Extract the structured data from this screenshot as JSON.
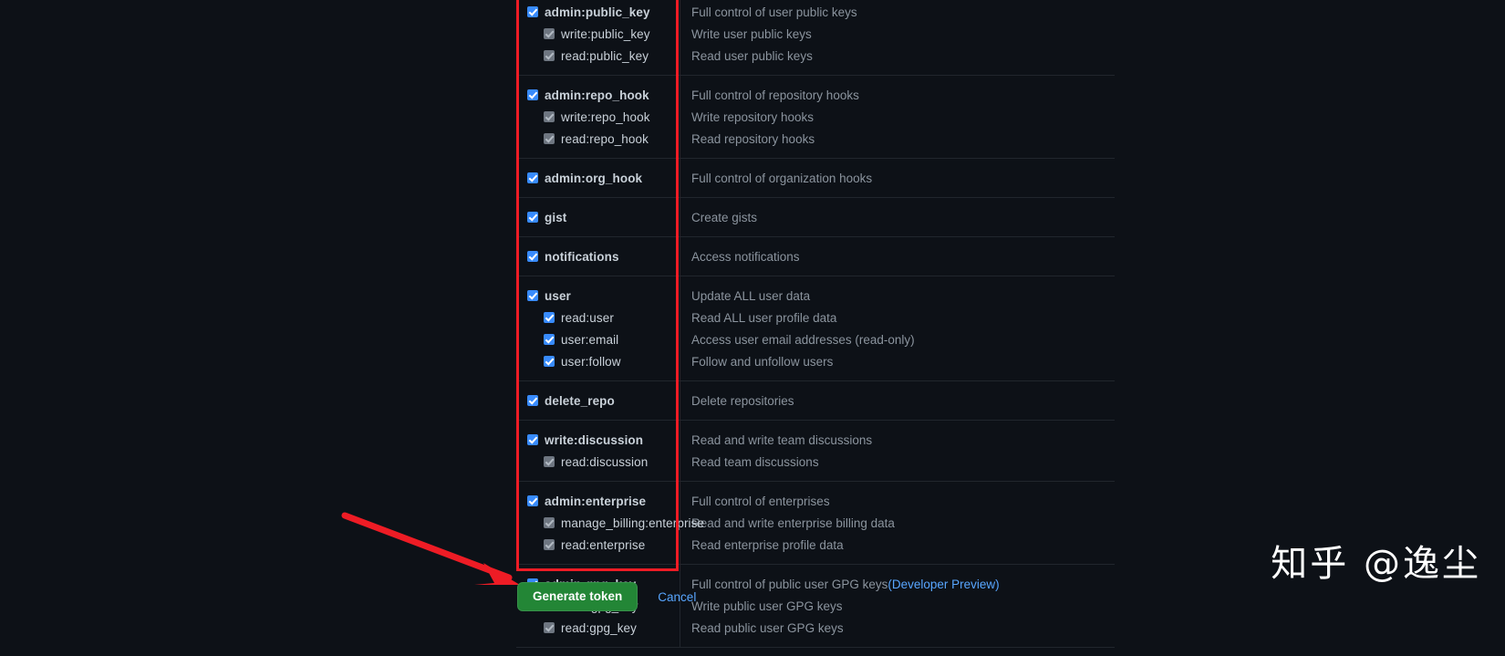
{
  "theme": {
    "background": "#0d1117",
    "border": "#21262d",
    "text_primary": "#c9d1d9",
    "text_muted": "#8b949e",
    "accent_link": "#58a6ff",
    "checkbox_on": "#388bfd",
    "checkbox_disabled": "#6e7681",
    "button_green": "#238636",
    "annotation_red": "#ee1c25"
  },
  "scopes": [
    {
      "name": "admin:public_key",
      "checked": true,
      "description": "Full control of user public keys",
      "children": [
        {
          "name": "write:public_key",
          "checked": true,
          "disabled": true,
          "description": "Write user public keys"
        },
        {
          "name": "read:public_key",
          "checked": true,
          "disabled": true,
          "description": "Read user public keys"
        }
      ]
    },
    {
      "name": "admin:repo_hook",
      "checked": true,
      "description": "Full control of repository hooks",
      "children": [
        {
          "name": "write:repo_hook",
          "checked": true,
          "disabled": true,
          "description": "Write repository hooks"
        },
        {
          "name": "read:repo_hook",
          "checked": true,
          "disabled": true,
          "description": "Read repository hooks"
        }
      ]
    },
    {
      "name": "admin:org_hook",
      "checked": true,
      "description": "Full control of organization hooks",
      "children": []
    },
    {
      "name": "gist",
      "checked": true,
      "description": "Create gists",
      "children": []
    },
    {
      "name": "notifications",
      "checked": true,
      "description": "Access notifications",
      "children": []
    },
    {
      "name": "user",
      "checked": true,
      "description": "Update ALL user data",
      "children": [
        {
          "name": "read:user",
          "checked": true,
          "disabled": false,
          "description": "Read ALL user profile data"
        },
        {
          "name": "user:email",
          "checked": true,
          "disabled": false,
          "description": "Access user email addresses (read-only)"
        },
        {
          "name": "user:follow",
          "checked": true,
          "disabled": false,
          "description": "Follow and unfollow users"
        }
      ]
    },
    {
      "name": "delete_repo",
      "checked": true,
      "description": "Delete repositories",
      "children": []
    },
    {
      "name": "write:discussion",
      "checked": true,
      "description": "Read and write team discussions",
      "children": [
        {
          "name": "read:discussion",
          "checked": true,
          "disabled": true,
          "description": "Read team discussions"
        }
      ]
    },
    {
      "name": "admin:enterprise",
      "checked": true,
      "description": "Full control of enterprises",
      "children": [
        {
          "name": "manage_billing:enterprise",
          "checked": true,
          "disabled": true,
          "description": "Read and write enterprise billing data"
        },
        {
          "name": "read:enterprise",
          "checked": true,
          "disabled": true,
          "description": "Read enterprise profile data"
        }
      ]
    },
    {
      "name": "admin:gpg_key",
      "checked": true,
      "description": "Full control of public user GPG keys ",
      "description_link": "(Developer Preview)",
      "children": [
        {
          "name": "write:gpg_key",
          "checked": true,
          "disabled": true,
          "description": "Write public user GPG keys"
        },
        {
          "name": "read:gpg_key",
          "checked": true,
          "disabled": true,
          "description": "Read public user GPG keys"
        }
      ]
    }
  ],
  "actions": {
    "generate_label": "Generate token",
    "cancel_label": "Cancel"
  },
  "annotations": {
    "highlight_box": "red-rectangle-around-scope-checkbox-column",
    "arrow": "red-arrow-pointing-to-generate-token-button"
  },
  "watermark": {
    "text": "知乎 @逸尘"
  }
}
